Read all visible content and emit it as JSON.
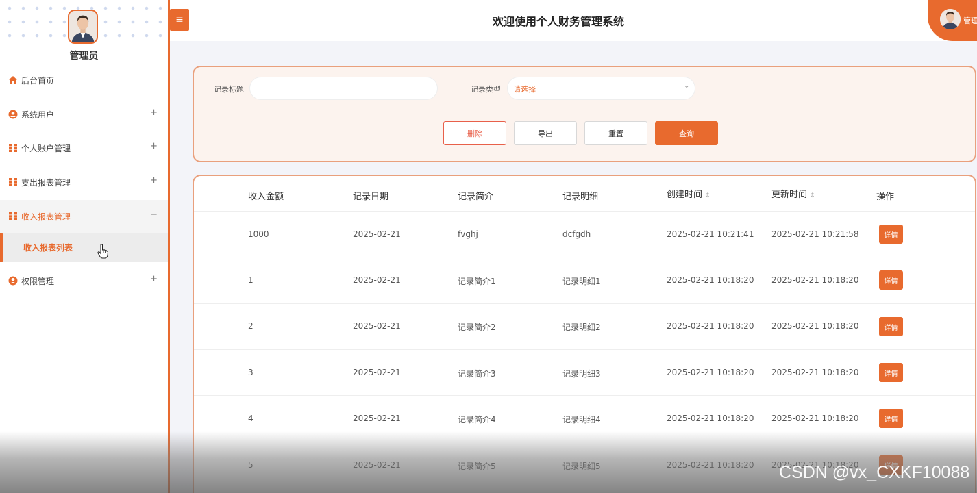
{
  "sidebar": {
    "user_name": "管理员",
    "items": [
      {
        "label": "后台首页",
        "icon": "home-icon",
        "toggle": ""
      },
      {
        "label": "系统用户",
        "icon": "user-circle-icon",
        "toggle": "+"
      },
      {
        "label": "个人账户管理",
        "icon": "grid-icon",
        "toggle": "+"
      },
      {
        "label": "支出报表管理",
        "icon": "grid-icon",
        "toggle": "+"
      },
      {
        "label": "收入报表管理",
        "icon": "grid-icon",
        "toggle": "−"
      },
      {
        "label": "权限管理",
        "icon": "user-circle-icon",
        "toggle": "+"
      }
    ],
    "active_sub_item": "收入报表列表"
  },
  "header": {
    "toggle_icon": "≡",
    "title": "欢迎使用个人财务管理系统",
    "user_name": "管理"
  },
  "search": {
    "title_label": "记录标题",
    "title_value": "",
    "type_label": "记录类型",
    "type_placeholder": "请选择",
    "buttons": {
      "delete": "删除",
      "export": "导出",
      "reset": "重置",
      "search": "查询"
    }
  },
  "table": {
    "columns": [
      "收入金额",
      "记录日期",
      "记录简介",
      "记录明细",
      "创建时间",
      "更新时间",
      "操作"
    ],
    "sort_glyph": "⇕",
    "action_label": "详情",
    "rows": [
      {
        "amount": "1000",
        "date": "2025-02-21",
        "intro": "fvghj",
        "detail": "dcfgdh",
        "created": "2025-02-21 10:21:41",
        "updated": "2025-02-21 10:21:58"
      },
      {
        "amount": "1",
        "date": "2025-02-21",
        "intro": "记录简介1",
        "detail": "记录明细1",
        "created": "2025-02-21 10:18:20",
        "updated": "2025-02-21 10:18:20"
      },
      {
        "amount": "2",
        "date": "2025-02-21",
        "intro": "记录简介2",
        "detail": "记录明细2",
        "created": "2025-02-21 10:18:20",
        "updated": "2025-02-21 10:18:20"
      },
      {
        "amount": "3",
        "date": "2025-02-21",
        "intro": "记录简介3",
        "detail": "记录明细3",
        "created": "2025-02-21 10:18:20",
        "updated": "2025-02-21 10:18:20"
      },
      {
        "amount": "4",
        "date": "2025-02-21",
        "intro": "记录简介4",
        "detail": "记录明细4",
        "created": "2025-02-21 10:18:20",
        "updated": "2025-02-21 10:18:20"
      },
      {
        "amount": "5",
        "date": "2025-02-21",
        "intro": "记录简介5",
        "detail": "记录明细5",
        "created": "2025-02-21 10:18:20",
        "updated": "2025-02-21 10:18:20"
      }
    ]
  },
  "watermark": "CSDN @vx_CXKF10088",
  "colors": {
    "accent": "#e86a2e",
    "panel_border": "#e9a07d",
    "panel_bg": "#fcf3ee",
    "delete": "#e8604a"
  }
}
